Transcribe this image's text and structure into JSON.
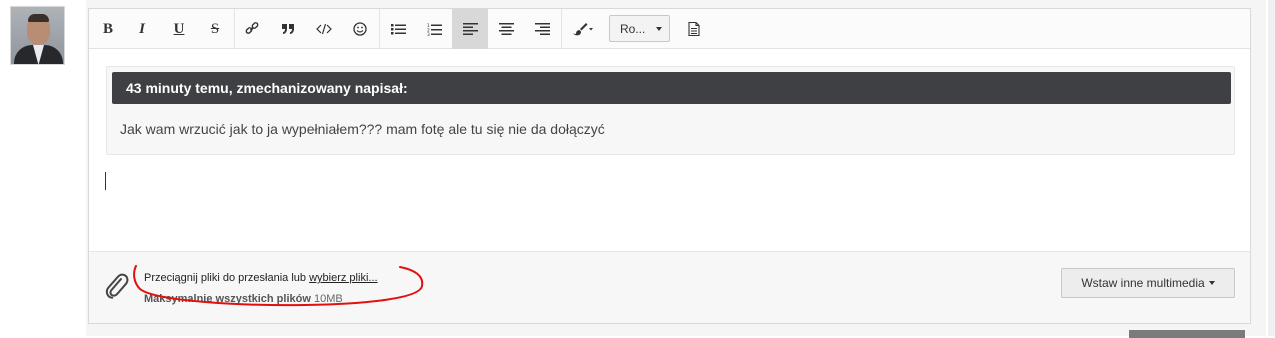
{
  "toolbar": {
    "bold": "B",
    "italic": "I",
    "underline": "U",
    "strike": "S",
    "font_value": "Ro..."
  },
  "quote": {
    "header": "43 minuty temu, zmechanizowany napisał:",
    "body": "Jak wam wrzucić jak to ja wypełniałem??? mam fotę ale tu się nie da dołączyć"
  },
  "attach": {
    "drag_text": "Przeciągnij pliki do przesłania lub ",
    "choose_link": "wybierz pliki...",
    "max_label": "Maksymalnie wszystkich plików",
    "max_size": "10MB",
    "media_button": "Wstaw inne multimedia"
  },
  "colors": {
    "quote_header_bg": "#3f4044",
    "annotation_red": "#e01010",
    "active_tool_bg": "#d8d8d8"
  },
  "icons": [
    "link-icon",
    "quote-icon",
    "code-icon",
    "emoji-icon",
    "bullet-list-icon",
    "numbered-list-icon",
    "align-left-icon",
    "align-center-icon",
    "align-right-icon",
    "paint-brush-icon",
    "document-icon",
    "paperclip-icon"
  ]
}
